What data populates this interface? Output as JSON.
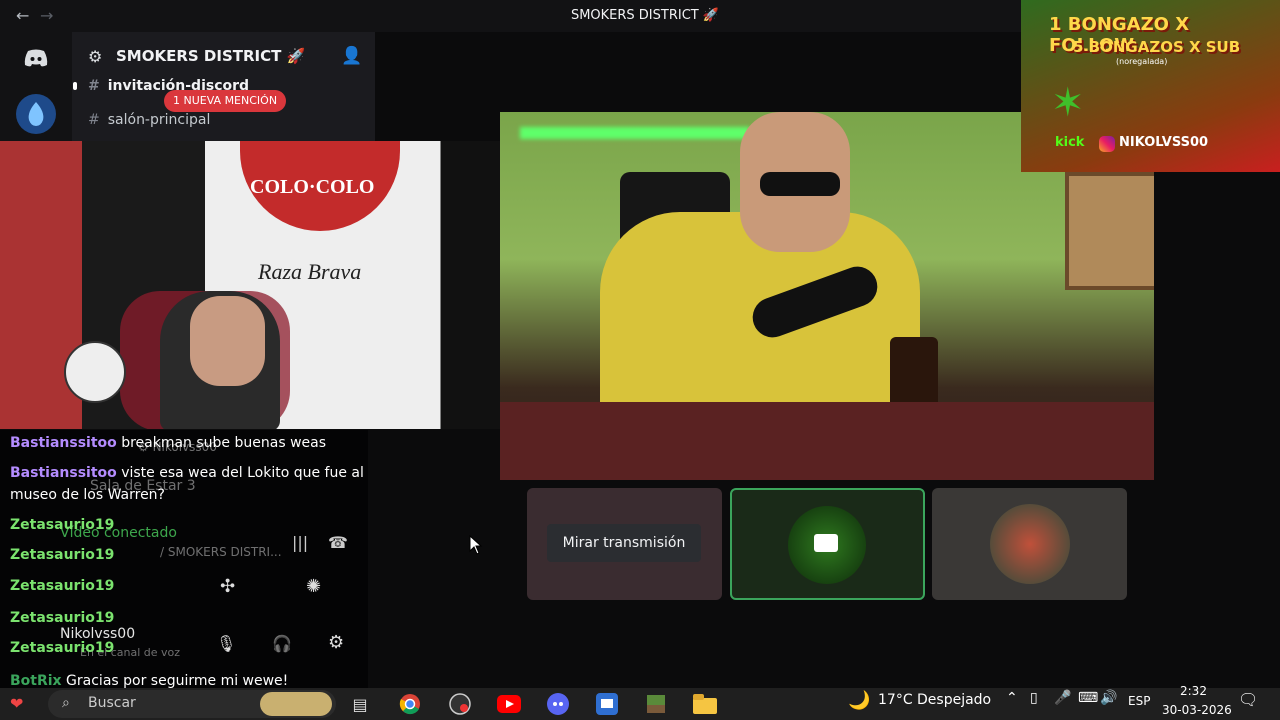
{
  "window": {
    "title": "SMOKERS DISTRICT 🚀",
    "back_arrow": "←",
    "forward_arrow": "→"
  },
  "discord": {
    "server_name": "SMOKERS DISTRICT 🚀",
    "channels": [
      {
        "label": "invitación-discord"
      },
      {
        "label": "salón-principal"
      }
    ],
    "mention_pill": "1 NUEVA MENCIÓN",
    "voice_channel": "Sala de Estar 3",
    "voice_status": "Vídeo conectado",
    "voice_location": "/ SMOKERS DISTRI...",
    "user_name": "Nikolvss00",
    "user_sub": "En el canal de voz"
  },
  "banner": {
    "line1": "1 BONGAZO X FOLLOW",
    "line2": "5 BONGAZOS X SUB",
    "line3": "(noregalada)",
    "platform": "kick",
    "handle": "NIKOLVSS00"
  },
  "left_cam": {
    "flag_text": "COLO·COLO",
    "flag_sub": "Raza Brava"
  },
  "stream": {
    "watch_button": "Mirar transmisión"
  },
  "chat": [
    {
      "name": "Bastianssitoo",
      "color": "purple",
      "text": "breakman sube buenas weas"
    },
    {
      "name": "Bastianssitoo",
      "color": "purple",
      "text": "viste esa wea del Lokito que fue al museo de los Warren?"
    },
    {
      "name": "Zetasaurio19",
      "color": "green",
      "text": ""
    },
    {
      "name": "Zetasaurio19",
      "color": "green",
      "text": ""
    },
    {
      "name": "Zetasaurio19",
      "color": "green",
      "text": ""
    },
    {
      "name": "Zetasaurio19",
      "color": "green",
      "text": ""
    },
    {
      "name": "Zetasaurio19",
      "color": "green",
      "text": ""
    },
    {
      "name": "BotRix",
      "color": "bot",
      "text": "Gracias por seguirme mi wewe!"
    }
  ],
  "taskbar": {
    "search_placeholder": "Buscar",
    "weather_temp": "17°C",
    "weather_desc": "Despejado",
    "language": "ESP",
    "time": "2:32",
    "date": "30-03-2026"
  },
  "colors": {
    "accent_green": "#3ba55c",
    "mention_red": "#da373c",
    "discord_blurple": "#5865f2"
  }
}
